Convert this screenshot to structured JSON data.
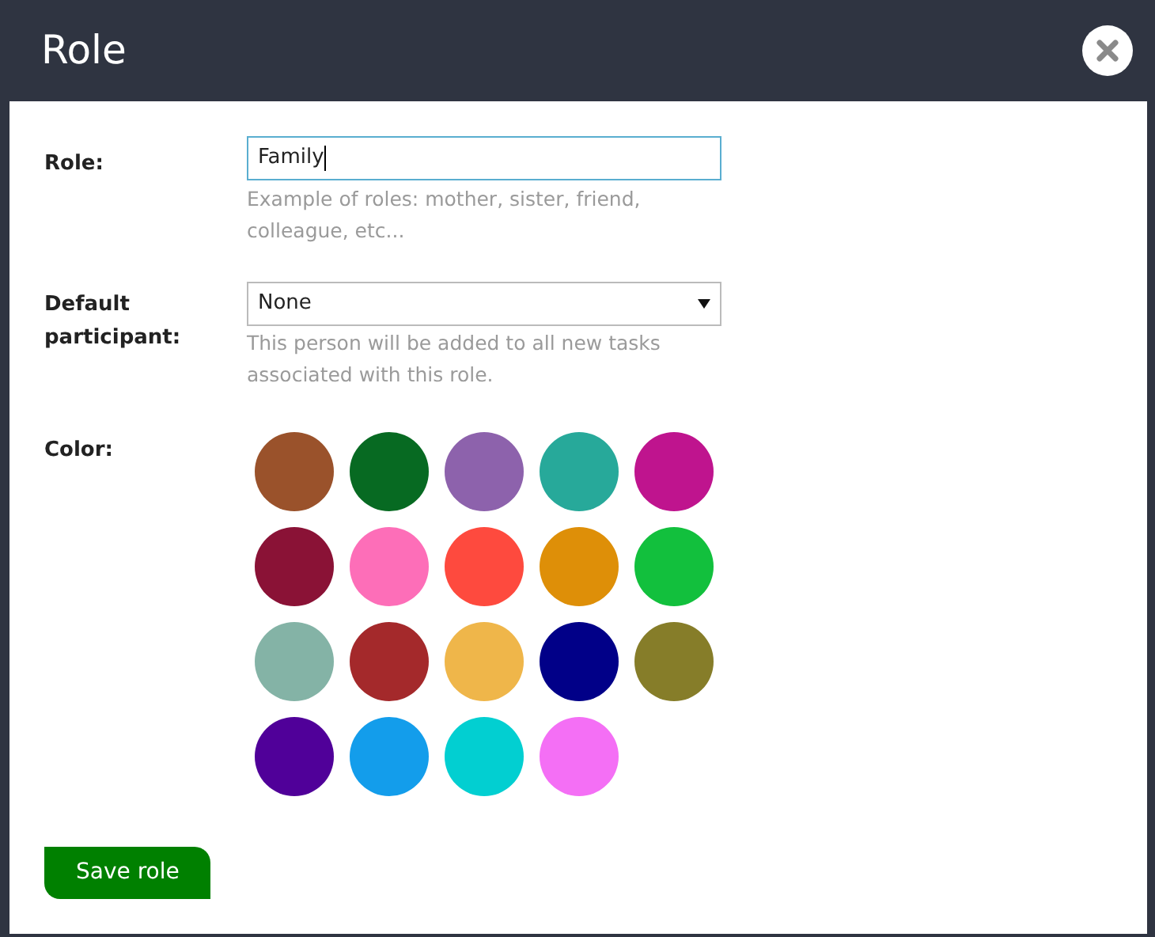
{
  "dialog": {
    "title": "Role"
  },
  "role": {
    "label": "Role:",
    "value": "Family",
    "hint": "Example of roles: mother, sister, friend, colleague, etc..."
  },
  "default_participant": {
    "label": "Default participant:",
    "value": "None",
    "hint": "This person will be added to all new tasks associated with this role."
  },
  "color": {
    "label": "Color:",
    "swatches": [
      {
        "color": "#9a522b"
      },
      {
        "color": "#076a22"
      },
      {
        "color": "#8d62ac"
      },
      {
        "color": "#27a99a"
      },
      {
        "color": "#bf148e"
      },
      {
        "color": "#8a1236"
      },
      {
        "color": "#fd6eb8"
      },
      {
        "color": "#fe4a3e"
      },
      {
        "color": "#de8f08"
      },
      {
        "color": "#12c03d"
      },
      {
        "color": "#84b3a6"
      },
      {
        "color": "#a4292b"
      },
      {
        "color": "#efb64a"
      },
      {
        "color": "#010088"
      },
      {
        "color": "#867d29"
      },
      {
        "color": "#500099"
      },
      {
        "color": "#139deb"
      },
      {
        "color": "#02cfd1"
      },
      {
        "color": "#f46ff5"
      }
    ]
  },
  "save_button": "Save role"
}
